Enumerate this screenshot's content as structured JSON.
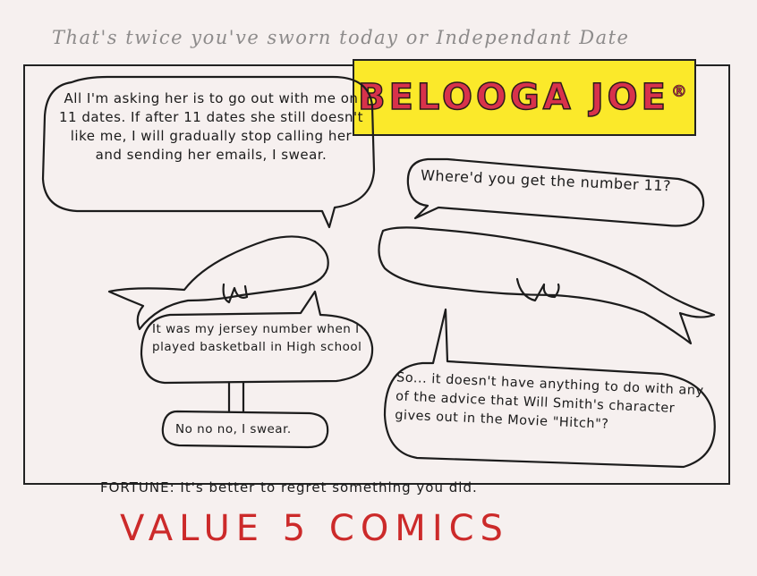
{
  "top_note": "That's twice you've sworn today or Independant Date",
  "title": "BELOOGA JOE",
  "title_mark": "®",
  "bubbles": {
    "b1": "All I'm asking her is to go out with me on 11 dates. If after 11 dates she still doesn't like me, I will gradually stop calling her and sending her emails, I swear.",
    "b2": "Where'd you get the number 11?",
    "b3": "It was my jersey number when I played basketball in High school",
    "b4": "No no no, I swear.",
    "b5": "So... it doesn't have anything to do with any of the advice that Will Smith's character gives out in the Movie \"Hitch\"?"
  },
  "fortune": "FORTUNE: It's better to regret something you did.",
  "footer": "VALUE 5 COMICS",
  "colors": {
    "paper": "#f6f0ef",
    "title_bg": "#fbe92a",
    "title_fg": "#d8324b",
    "footer": "#cc2a2a",
    "top_note": "#8d8b8b"
  }
}
